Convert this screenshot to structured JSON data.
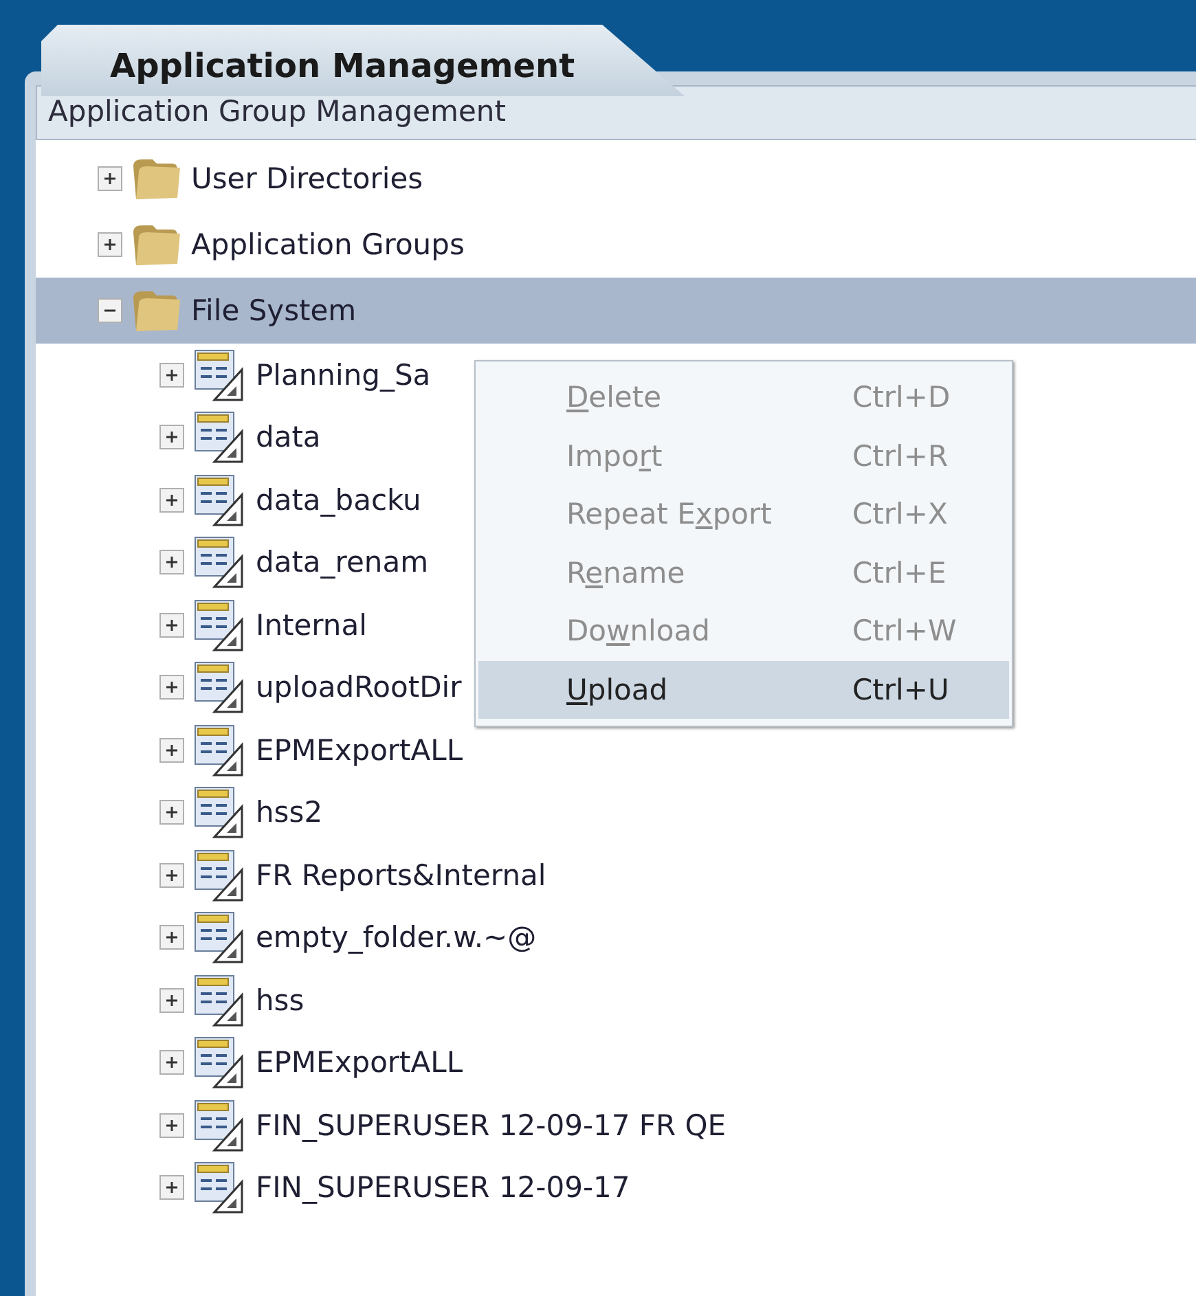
{
  "tabs": [
    {
      "label": "Application Management",
      "selected": true
    }
  ],
  "section": {
    "title": "Application Group Management"
  },
  "tree": [
    {
      "label": "User Directories",
      "kind": "folder",
      "expanded": false,
      "selected": false
    },
    {
      "label": "Application Groups",
      "kind": "folder",
      "expanded": false,
      "selected": false
    },
    {
      "label": "File System",
      "kind": "folder",
      "expanded": true,
      "selected": true,
      "children": [
        {
          "label": "Planning_Sa",
          "kind": "archive",
          "expanded": false,
          "selected": false
        },
        {
          "label": "data",
          "kind": "archive",
          "expanded": false,
          "selected": false
        },
        {
          "label": "data_backu",
          "kind": "archive",
          "expanded": false,
          "selected": false
        },
        {
          "label": "data_renam",
          "kind": "archive",
          "expanded": false,
          "selected": false
        },
        {
          "label": "Internal",
          "kind": "archive",
          "expanded": false,
          "selected": false
        },
        {
          "label": "uploadRootDir",
          "kind": "archive",
          "expanded": false,
          "selected": false
        },
        {
          "label": "EPMExportALL",
          "kind": "archive",
          "expanded": false,
          "selected": false
        },
        {
          "label": "hss2",
          "kind": "archive",
          "expanded": false,
          "selected": false
        },
        {
          "label": "FR Reports&Internal",
          "kind": "archive",
          "expanded": false,
          "selected": false
        },
        {
          "label": "empty_folder.w.~@",
          "kind": "archive",
          "expanded": false,
          "selected": false
        },
        {
          "label": "hss",
          "kind": "archive",
          "expanded": false,
          "selected": false
        },
        {
          "label": "EPMExportALL",
          "kind": "archive",
          "expanded": false,
          "selected": false
        },
        {
          "label": "FIN_SUPERUSER 12-09-17 FR QE",
          "kind": "archive",
          "expanded": false,
          "selected": false
        },
        {
          "label": "FIN_SUPERUSER 12-09-17",
          "kind": "archive",
          "expanded": false,
          "selected": false
        }
      ]
    }
  ],
  "context_menu": {
    "items": [
      {
        "label": [
          {
            "text": "D",
            "underlined": true
          },
          {
            "text": "elete",
            "underlined": false
          }
        ],
        "shortcut": "Ctrl+D",
        "disabled": true,
        "selected": false
      },
      {
        "label": [
          {
            "text": "Impo",
            "underlined": false
          },
          {
            "text": "r",
            "underlined": true
          },
          {
            "text": "t",
            "underlined": false
          }
        ],
        "shortcut": "Ctrl+R",
        "disabled": true,
        "selected": false
      },
      {
        "label": [
          {
            "text": "Repeat E",
            "underlined": false
          },
          {
            "text": "x",
            "underlined": true
          },
          {
            "text": "port",
            "underlined": false
          }
        ],
        "shortcut": "Ctrl+X",
        "disabled": true,
        "selected": false
      },
      {
        "label": [
          {
            "text": "R",
            "underlined": false
          },
          {
            "text": "e",
            "underlined": true
          },
          {
            "text": "name",
            "underlined": false
          }
        ],
        "shortcut": "Ctrl+E",
        "disabled": true,
        "selected": false
      },
      {
        "label": [
          {
            "text": "Do",
            "underlined": false
          },
          {
            "text": "w",
            "underlined": true
          },
          {
            "text": "nload",
            "underlined": false
          }
        ],
        "shortcut": "Ctrl+W",
        "disabled": true,
        "selected": false
      },
      {
        "label": [
          {
            "text": "U",
            "underlined": true
          },
          {
            "text": "pload",
            "underlined": false
          }
        ],
        "shortcut": "Ctrl+U",
        "disabled": false,
        "selected": true
      }
    ]
  }
}
